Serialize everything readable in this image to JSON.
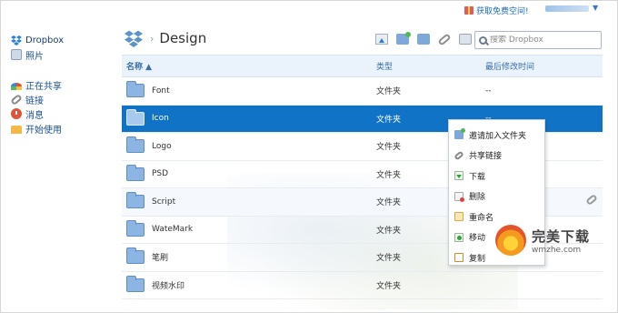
{
  "topbar": {
    "gift_text": "获取免费空间!",
    "user_caret": "▼"
  },
  "sidebar": {
    "items": [
      {
        "label": "Dropbox",
        "icon": "dropbox-icon"
      },
      {
        "label": "照片",
        "icon": "photo-icon"
      },
      {
        "label": "正在共享",
        "icon": "rainbow-icon"
      },
      {
        "label": "链接",
        "icon": "link-icon"
      },
      {
        "label": "消息",
        "icon": "alert-icon"
      },
      {
        "label": "开始使用",
        "icon": "cake-icon"
      }
    ]
  },
  "header": {
    "separator": "›",
    "title": "Design"
  },
  "toolbar": {
    "buttons": [
      "upload-icon",
      "new-folder-icon",
      "share-folder-icon",
      "link-icon",
      "history-icon"
    ]
  },
  "search": {
    "placeholder": "搜索 Dropbox"
  },
  "table": {
    "headers": {
      "name": "名称 ▲",
      "type": "类型",
      "modified": "最后修改时间"
    },
    "rows": [
      {
        "name": "Font",
        "type": "文件夹",
        "modified": "--"
      },
      {
        "name": "Icon",
        "type": "文件夹",
        "modified": "--",
        "selected": true
      },
      {
        "name": "Logo",
        "type": "文件夹",
        "modified": ""
      },
      {
        "name": "PSD",
        "type": "文件夹",
        "modified": ""
      },
      {
        "name": "Script",
        "type": "文件夹",
        "modified": ""
      },
      {
        "name": "WateMark",
        "type": "文件夹",
        "modified": ""
      },
      {
        "name": "笔刷",
        "type": "文件夹",
        "modified": ""
      },
      {
        "name": "视频水印",
        "type": "文件夹",
        "modified": ""
      }
    ]
  },
  "context_menu": {
    "items": [
      {
        "label": "邀请加入文件夹",
        "icon": "invite-folder-icon"
      },
      {
        "label": "共享链接",
        "icon": "link-icon"
      },
      {
        "label": "下载",
        "icon": "download-icon"
      },
      {
        "label": "删除",
        "icon": "delete-icon"
      },
      {
        "label": "重命名",
        "icon": "rename-icon"
      },
      {
        "label": "移动",
        "icon": "move-icon"
      },
      {
        "label": "复制",
        "icon": "copy-icon"
      }
    ]
  },
  "watermark": {
    "title": "完美下载",
    "site": "wmzhe.com"
  },
  "colors": {
    "selected_row": "#1173c6",
    "header_bg": "#eaf3fb",
    "link": "#1a4f8b"
  }
}
